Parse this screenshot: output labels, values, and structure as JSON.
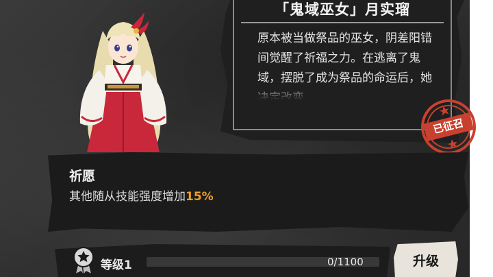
{
  "story": {
    "title": "「鬼域巫女」月实瑠",
    "description": "原本被当做祭品的巫女，阴差阳错间觉醒了祈福之力。在逃离了鬼域，摆脱了成为祭品的命运后，她决定改变"
  },
  "stamp": {
    "text": "已征召",
    "color": "#c8412f"
  },
  "skill": {
    "name": "祈愿",
    "description": "其他随从技能强度增加",
    "value": "15%",
    "highlight_color": "#f0a020"
  },
  "level": {
    "label": "等级1",
    "progress_text": "0/1100",
    "progress_fraction": 0
  },
  "upgrade_button": {
    "label": "升级"
  },
  "icons": {
    "medal": "medal-icon",
    "character": "shrine-maiden-portrait"
  }
}
